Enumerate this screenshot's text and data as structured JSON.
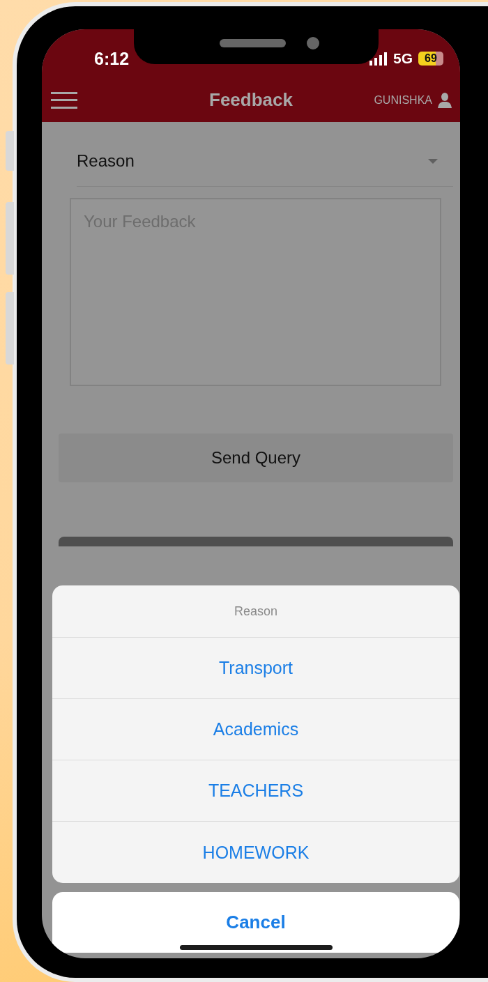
{
  "status_bar": {
    "time": "6:12",
    "network": "5G",
    "battery": "69"
  },
  "header": {
    "title": "Feedback",
    "user": "GUNISHKA"
  },
  "form": {
    "reason": "Reason",
    "feedback": {
      "placeholder": "Your Feedback"
    },
    "submit": "Send Query"
  },
  "action_sheet": {
    "title": "Reason",
    "options": [
      "Transport",
      "Academics",
      "TEACHERS",
      "HOMEWORK"
    ],
    "cancel": "Cancel"
  }
}
